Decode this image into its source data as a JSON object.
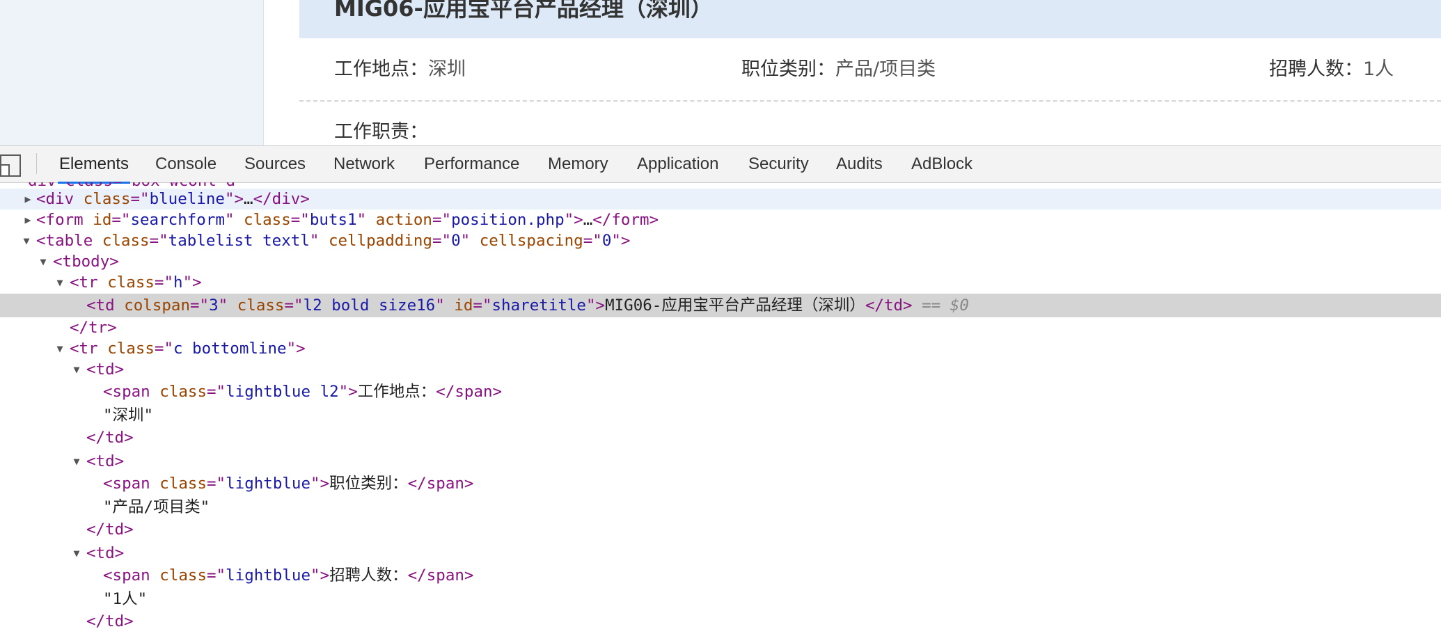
{
  "page": {
    "job_title": "MIG06-应用宝平台产品经理（深圳）",
    "location_label": "工作地点：",
    "location_value": "深圳",
    "category_label": "职位类别：",
    "category_value": "产品/项目类",
    "headcount_label": "招聘人数：",
    "headcount_value": "1人",
    "duty_label": "工作职责："
  },
  "devtools": {
    "tabs": [
      "Elements",
      "Console",
      "Sources",
      "Network",
      "Performance",
      "Memory",
      "Application",
      "Security",
      "Audits",
      "AdBlock"
    ],
    "active_tab": "Elements",
    "icons": {
      "device_toggle": "device-toolbar-icon",
      "expand": "triangle-right-icon",
      "collapse": "triangle-down-icon"
    },
    "tree": {
      "cut_line": "div class=\"box wcont_d\"",
      "l1_tag": "div",
      "l1_attr": "class",
      "l1_val": "blueline",
      "l1_ellipsis": "…",
      "l1_close": "</div>",
      "l2_tag": "form",
      "l2_attr1": "id",
      "l2_val1": "searchform",
      "l2_attr2": "class",
      "l2_val2": "buts1",
      "l2_attr3": "action",
      "l2_val3": "position.php",
      "l2_ellipsis": "…",
      "l2_close": "</form>",
      "l3_tag": "table",
      "l3_attr1": "class",
      "l3_val1": "tablelist textl",
      "l3_attr2": "cellpadding",
      "l3_val2": "0",
      "l3_attr3": "cellspacing",
      "l3_val3": "0",
      "l4_tag": "tbody",
      "l5_tag": "tr",
      "l5_attr": "class",
      "l5_val": "h",
      "l6_tag": "td",
      "l6_attr1": "colspan",
      "l6_val1": "3",
      "l6_attr2": "class",
      "l6_val2": "l2 bold size16",
      "l6_attr3": "id",
      "l6_val3": "sharetitle",
      "l6_text": "MIG06-应用宝平台产品经理（深圳）",
      "l6_close": "</td>",
      "l6_ref": "== $0",
      "l7_close": "</tr>",
      "l8_tag": "tr",
      "l8_attr": "class",
      "l8_val": "c bottomline",
      "td_tag": "td",
      "span_tag": "span",
      "span_attr": "class",
      "l10_val": "lightblue l2",
      "l10_text": "工作地点：",
      "span_close": "</span>",
      "l11_text": "\"深圳\"",
      "td_close": "</td>",
      "l14_val": "lightblue",
      "l14_text": "职位类别：",
      "l15_text": "\"产品/项目类\"",
      "l18_val": "lightblue",
      "l18_text": "招聘人数：",
      "l19_text": "\"1人\""
    }
  }
}
